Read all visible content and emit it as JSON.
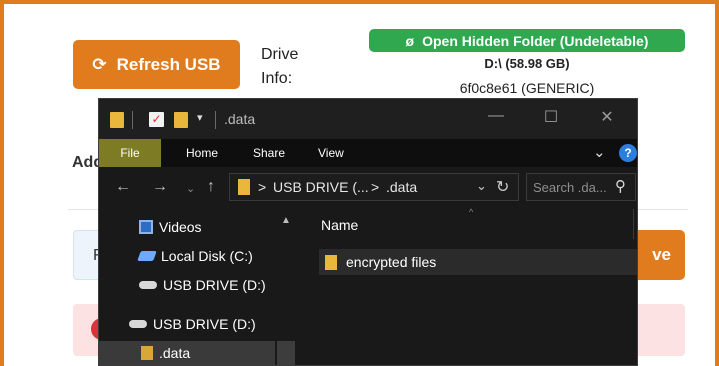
{
  "app": {
    "refresh_button": {
      "icon": "refresh-icon",
      "label": "Refresh USB"
    },
    "drive_info": {
      "label": "Drive Info:",
      "drive": "D:\\ (58.98 GB)",
      "id": "6f0c8e61 (GENERIC)"
    },
    "hidden_folder_button": {
      "icon": "eye-slash-icon",
      "label": "Open Hidden Folder (Undeletable)"
    },
    "partial": {
      "add_text": "Add",
      "field_text": "F",
      "save_text": "ve"
    },
    "colors": {
      "accent": "#e07b1e",
      "success": "#2fa84f",
      "alert_bg": "#fde2e3",
      "alert_icon": "#d9343a"
    }
  },
  "explorer": {
    "title": ".data",
    "title_icons": [
      "folder-icon",
      "checkmark-icon",
      "folder-icon",
      "dropdown-icon"
    ],
    "window_buttons": {
      "minimize": "—",
      "maximize": "☐",
      "close": "✕"
    },
    "menu": {
      "file": "File",
      "items": [
        "Home",
        "Share",
        "View"
      ]
    },
    "nav_buttons": {
      "back": "←",
      "forward": "→",
      "recent": "⌄",
      "up": "↑"
    },
    "address": {
      "segments": [
        "USB DRIVE (...",
        ".data"
      ],
      "separator": ">"
    },
    "search": {
      "placeholder": "Search .da..."
    },
    "nav_pane": [
      {
        "label": "Videos",
        "icon": "video-icon"
      },
      {
        "label": "Local Disk (C:)",
        "icon": "disk-icon"
      },
      {
        "label": "USB DRIVE (D:)",
        "icon": "usb-drive-icon"
      },
      {
        "label": "USB DRIVE (D:)",
        "icon": "usb-drive-icon"
      },
      {
        "label": ".data",
        "icon": "folder-icon",
        "selected": true
      }
    ],
    "content": {
      "column_header": "Name",
      "files": [
        {
          "name": "encrypted files",
          "icon": "folder-icon"
        }
      ]
    }
  }
}
